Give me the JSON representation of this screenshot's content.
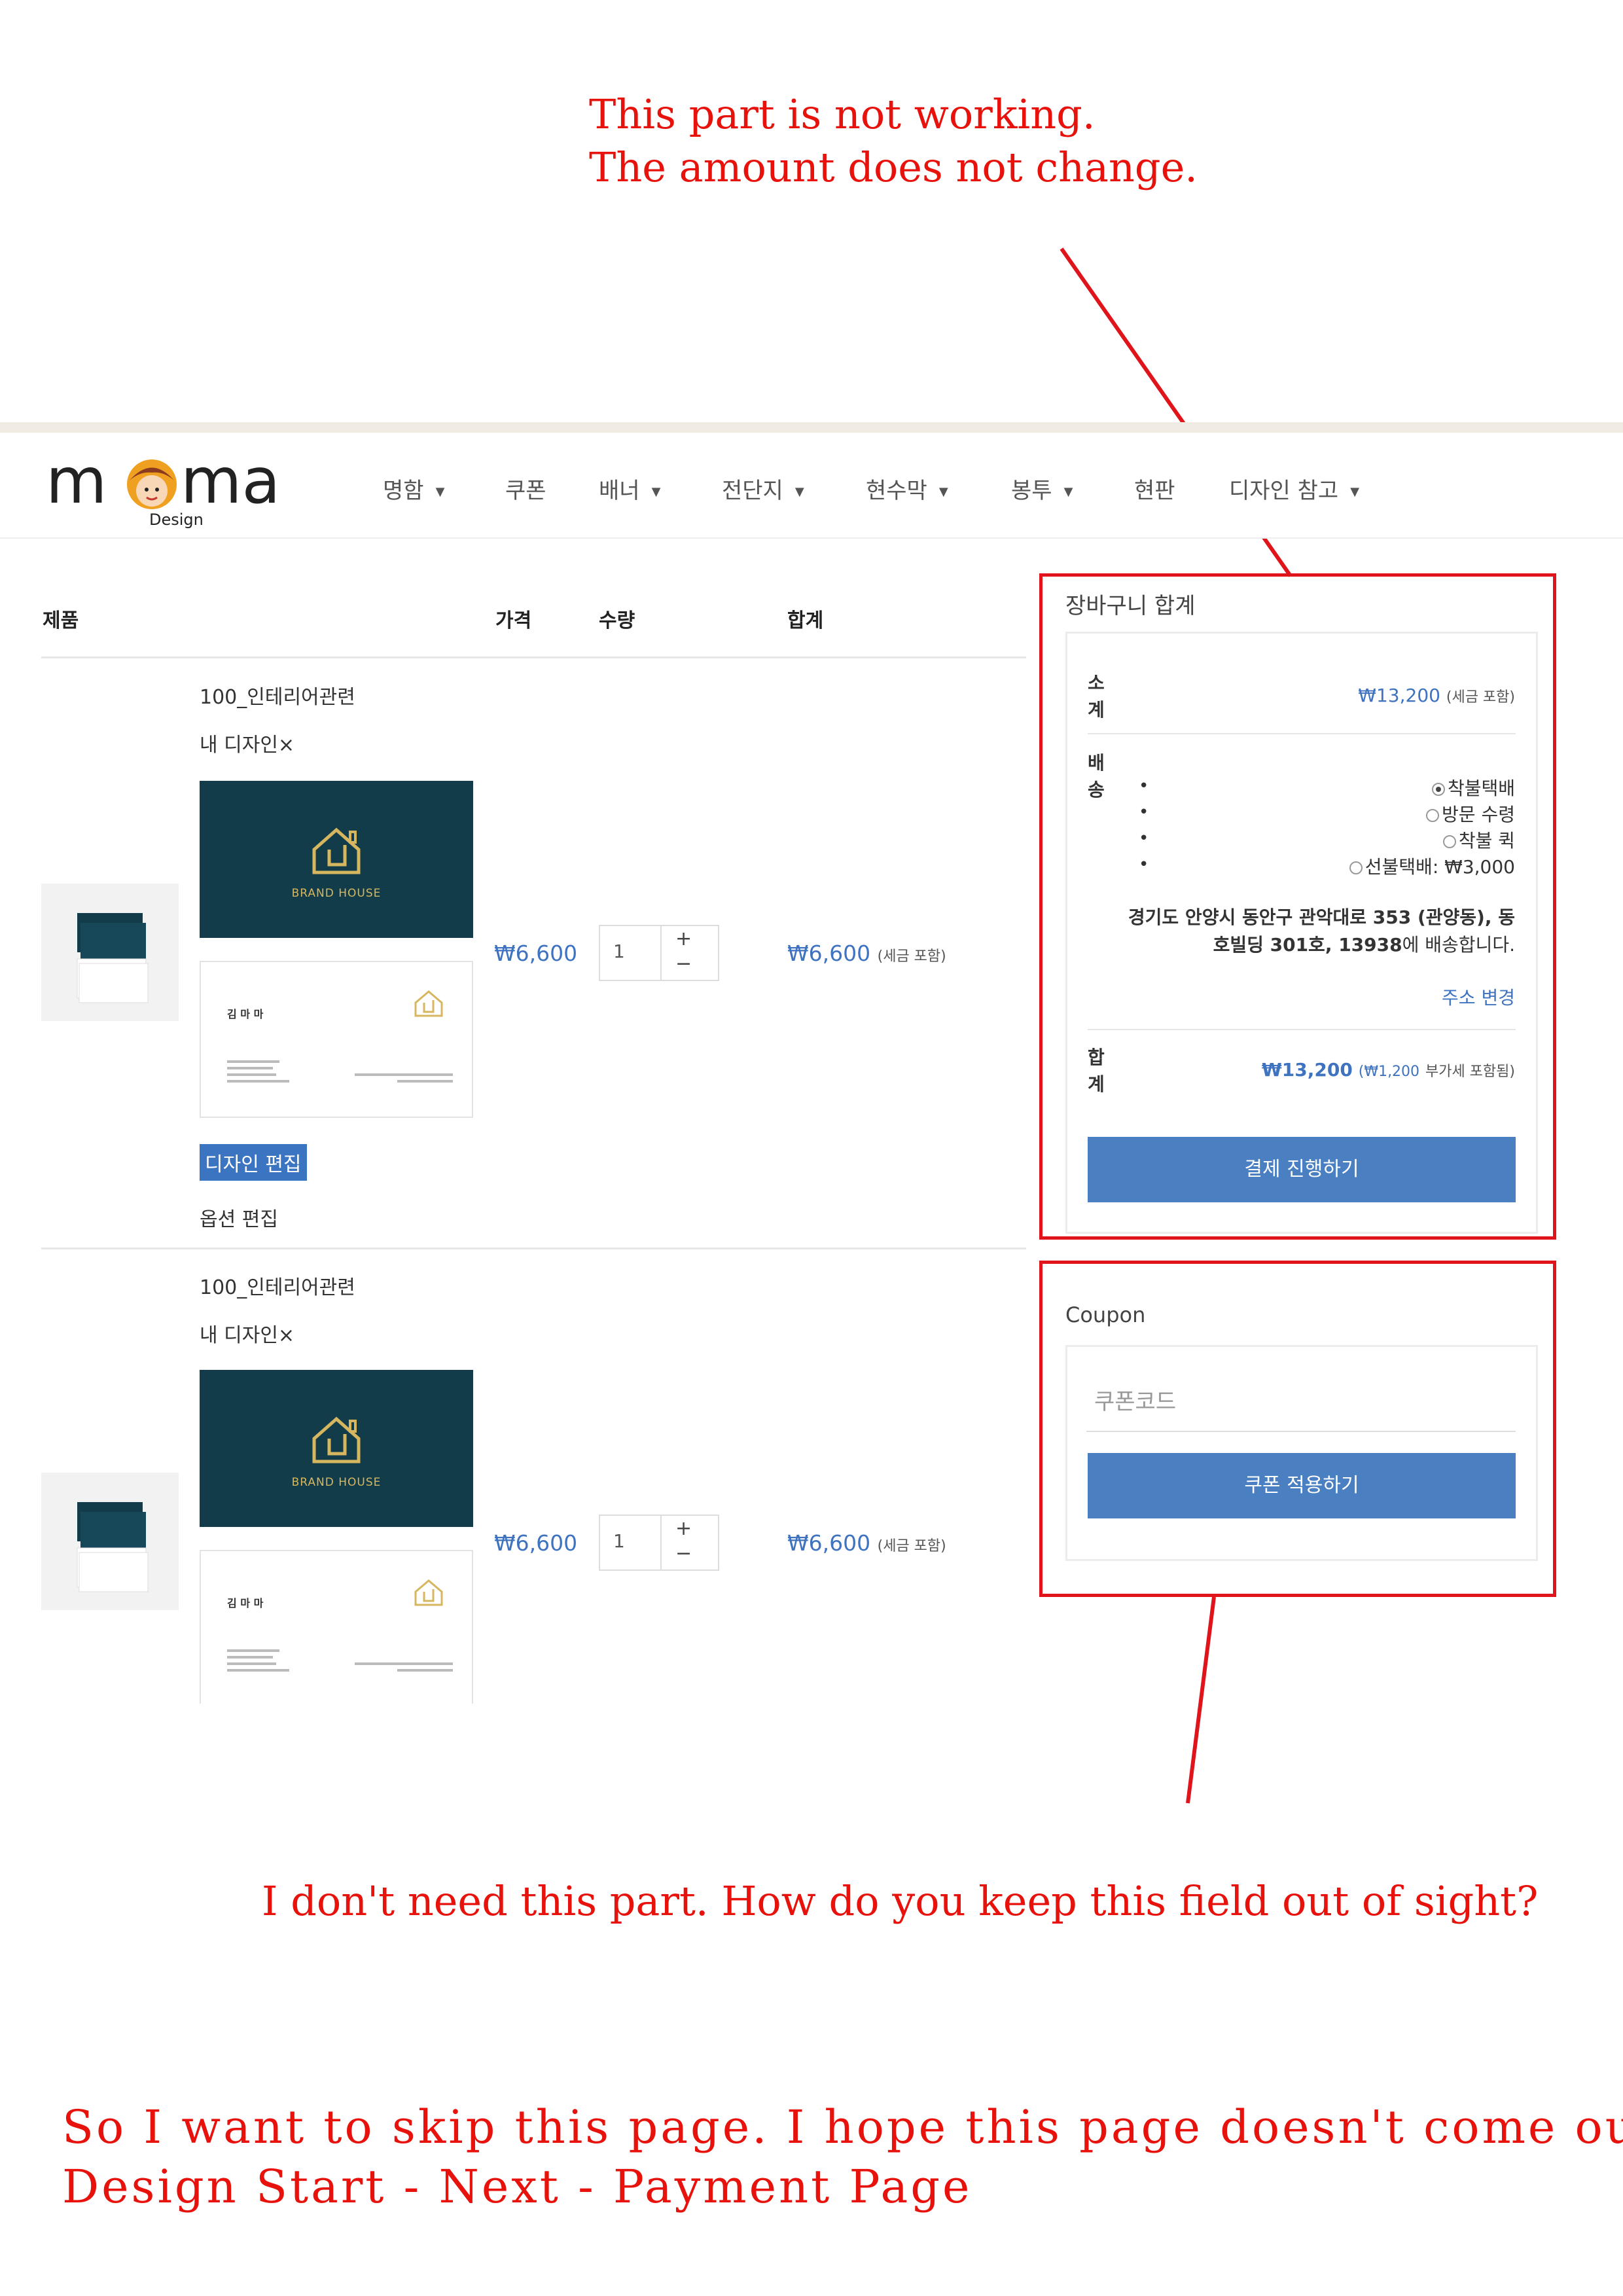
{
  "annotations": {
    "top_note_line1": "This part is not working.",
    "top_note_line2": "The amount does not change.",
    "coupon_note": "I don't need this part. How do you keep this field out of sight?",
    "bottom_note_line1": "So I want to skip this page. I hope this page doesn't come out.",
    "bottom_note_line2": "Design Start - Next - Payment Page"
  },
  "logo": {
    "text": "mama",
    "sub": "Design"
  },
  "nav": {
    "items": [
      {
        "label": "명함",
        "caret": "▼"
      },
      {
        "label": "쿠폰",
        "caret": ""
      },
      {
        "label": "배너",
        "caret": "▼"
      },
      {
        "label": "전단지",
        "caret": "▼"
      },
      {
        "label": "현수막",
        "caret": "▼"
      },
      {
        "label": "봉투",
        "caret": "▼"
      },
      {
        "label": "현판",
        "caret": ""
      },
      {
        "label": "디자인 참고",
        "caret": "▼"
      }
    ]
  },
  "cart_table": {
    "headers": {
      "product": "제품",
      "price": "가격",
      "quantity": "수량",
      "total": "합계"
    },
    "items": [
      {
        "category": "100_인테리어관련",
        "design_label": "내 디자인×",
        "card": {
          "brand": "BRAND HOUSE",
          "name": "김 마 마"
        },
        "price": "₩6,600",
        "quantity": "1",
        "total": "₩6,600",
        "tax_note": "(세금 포함)",
        "edit_design": "디자인 편집",
        "edit_options": "옵션 편집"
      },
      {
        "category": "100_인테리어관련",
        "design_label": "내 디자인×",
        "card": {
          "brand": "BRAND HOUSE",
          "name": "김 마 마"
        },
        "price": "₩6,600",
        "quantity": "1",
        "total": "₩6,600",
        "tax_note": "(세금 포함)"
      }
    ],
    "qty_plus": "+",
    "qty_minus": "−"
  },
  "cart_totals": {
    "title": "장바구니 합계",
    "subtotal_label": "소\n계",
    "subtotal_value": "₩13,200",
    "subtotal_note": "(세금 포함)",
    "shipping_label": "배\n송",
    "shipping_options": [
      "착불택배",
      "방문 수령",
      "착불 퀵",
      "선불택배: ₩3,000"
    ],
    "shipping_address": "경기도 안양시 동안구 관악대로 353 (관양동), 동",
    "shipping_address2": "호빌딩 301호, 13938",
    "shipping_address_suffix": "에 배송합니다.",
    "change_address": "주소 변경",
    "total_label": "합\n계",
    "total_value": "₩13,200",
    "total_vat": "(₩1,200",
    "total_vat_suffix": "부가세 포함됨)",
    "checkout_button": "결제 진행하기"
  },
  "coupon": {
    "title": "Coupon",
    "placeholder": "쿠폰코드",
    "apply_button": "쿠폰 적용하기"
  },
  "colors": {
    "annotation_red": "#e0141b",
    "accent_blue": "#4a7fc1",
    "card_teal": "#123c4a",
    "gold": "#d6b75f"
  }
}
